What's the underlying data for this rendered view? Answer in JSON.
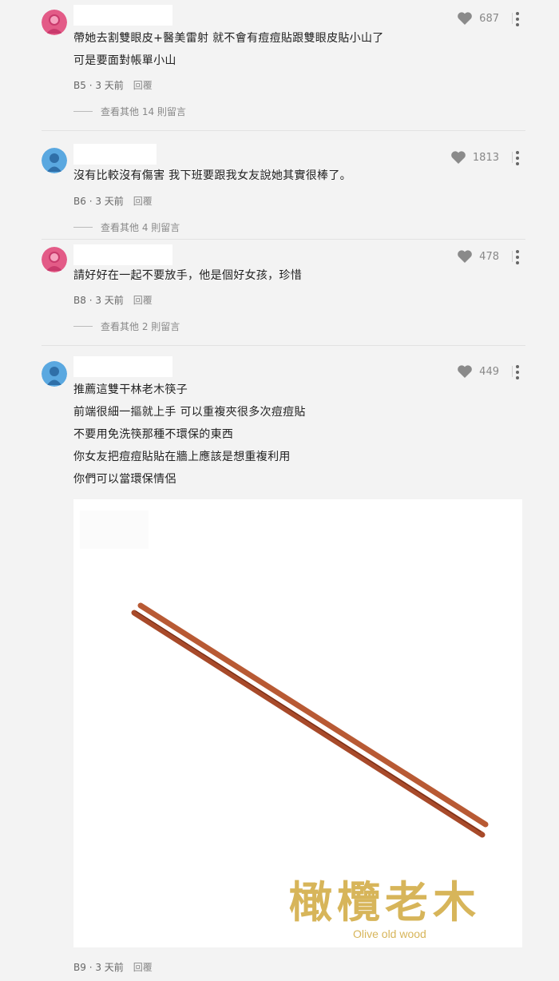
{
  "colors": {
    "background": "#f3f3f3",
    "avatar_female": "#e35b87",
    "avatar_male": "#5aa8e0",
    "heart": "#8a8a8a",
    "brand_gold": "#d7b55a",
    "chopstick": "#a84a2a"
  },
  "comments": [
    {
      "avatar": "female-avatar-icon",
      "likes": "687",
      "lines": [
        "帶她去割雙眼皮+醫美雷射 就不會有痘痘貼跟雙眼皮貼小山了",
        "可是要面對帳單小山"
      ],
      "floor": "B5",
      "time": "3 天前",
      "reply": "回覆",
      "more": "查看其他 14 則留言"
    },
    {
      "avatar": "male-avatar-icon",
      "likes": "1813",
      "lines": [
        "沒有比較沒有傷害 我下班要跟我女友說她其實很棒了。"
      ],
      "floor": "B6",
      "time": "3 天前",
      "reply": "回覆",
      "more": "查看其他 4 則留言"
    },
    {
      "avatar": "female-avatar-icon",
      "likes": "478",
      "lines": [
        "請好好在一起不要放手，他是個好女孩，珍惜"
      ],
      "floor": "B8",
      "time": "3 天前",
      "reply": "回覆",
      "more": "查看其他 2 則留言"
    },
    {
      "avatar": "male-avatar-icon",
      "likes": "449",
      "lines": [
        "推薦這雙干林老木筷子",
        "前端很細一摳就上手 可以重複夾很多次痘痘貼",
        "不要用免洗筷那種不環保的東西",
        "你女友把痘痘貼貼在牆上應該是想重複利用",
        "你們可以當環保情侶"
      ],
      "floor": "B9",
      "time": "3 天前",
      "reply": "回覆",
      "image": {
        "brand_zh": "橄欖老木",
        "brand_en": "Olive old wood"
      }
    }
  ]
}
